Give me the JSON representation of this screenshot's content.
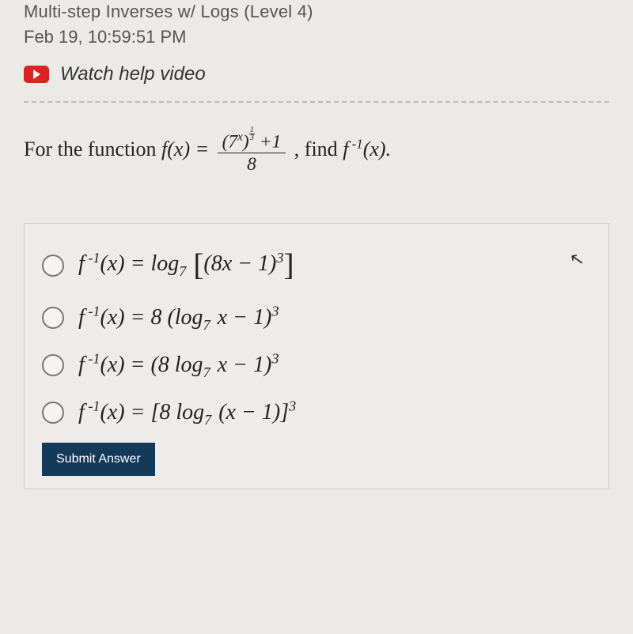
{
  "header": {
    "title": "Multi-step Inverses w/ Logs (Level 4)",
    "timestamp": "Feb 19, 10:59:51 PM",
    "video_label": "Watch help video"
  },
  "question": {
    "lead": "For the function ",
    "find_text": ", find "
  },
  "options": {
    "a_prefix": "f",
    "b_prefix": "f",
    "c_prefix": "f",
    "d_prefix": "f"
  },
  "submit": {
    "label": "Submit Answer"
  }
}
